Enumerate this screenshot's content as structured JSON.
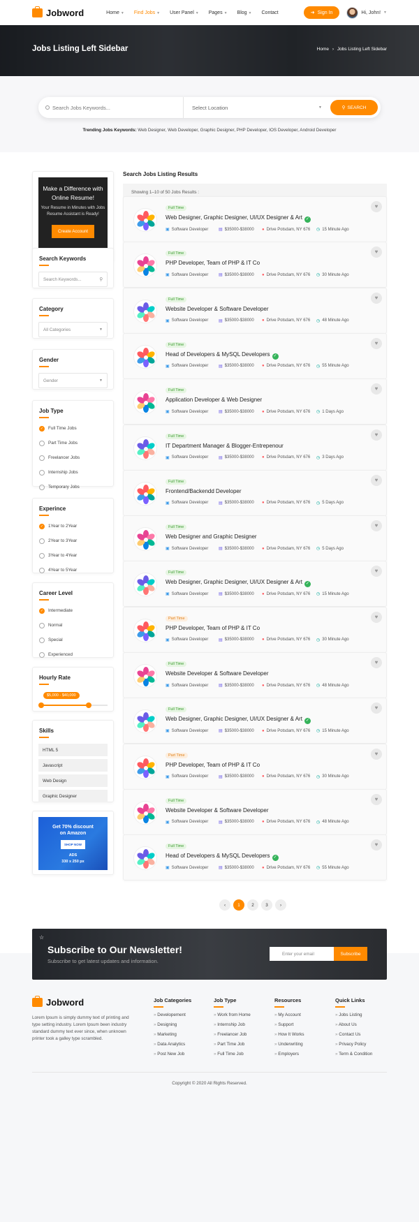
{
  "brand": {
    "name": "Jobword"
  },
  "nav": {
    "items": [
      "Home",
      "Find Jobs",
      "User Panel",
      "Pages",
      "Blog",
      "Contact"
    ],
    "signin": "Sign In",
    "user": "Hi, John!"
  },
  "hero": {
    "title": "Jobs Listing Left Sidebar",
    "crumb_home": "Home",
    "crumb_sep": "›",
    "crumb_current": "Jobs Listing Left Sidebar"
  },
  "search": {
    "keywords_placeholder": "Search Jobs Keywords...",
    "location": "Select Location",
    "button": "SEARCH",
    "trending_label": "Trending Jobs Keywords:",
    "trending": " Web Designer, Web Developer, Graphic Designer, PHP Developer, IOS Developer, Android Developer"
  },
  "sidebar": {
    "promo": {
      "title": "Make a Difference with Online Resume!",
      "text": "Your Resume in Minutes with Jobs Resume Assistant is Ready!",
      "button": "Create Account"
    },
    "keywords": {
      "title": "Search Keywords",
      "placeholder": "Search Keywords..."
    },
    "category": {
      "title": "Category",
      "value": "All Categories"
    },
    "gender": {
      "title": "Gender",
      "value": "Gender"
    },
    "job_type": {
      "title": "Job Type",
      "options": [
        "Full Time Jobs",
        "Part Time Jobs",
        "Freelancer Jobs",
        "Internship Jobs",
        "Temporary Jobs"
      ]
    },
    "experience": {
      "title": "Experince",
      "options": [
        "1Year to 2Year",
        "2Year to 3Year",
        "3Year to 4Year",
        "4Year to 5Year"
      ]
    },
    "career": {
      "title": "Career Level",
      "options": [
        "Intermediate",
        "Normal",
        "Special",
        "Experienced"
      ]
    },
    "rate": {
      "title": "Hourly Rate",
      "range": "$5,000 - $40,000"
    },
    "skills": {
      "title": "Skills",
      "items": [
        "HTML 5",
        "Javascript",
        "Web Design",
        "Graphic Designer"
      ]
    },
    "ad": {
      "line1": "Get 70% discount",
      "line2": "on Amazon",
      "shop": "SHOP NOW",
      "ads": "ADS",
      "size": "330 x 250 px"
    }
  },
  "main": {
    "title": "Search Jobs Listing Results",
    "count": "Showing 1–10 of 50 Jobs Results :"
  },
  "jobs": [
    {
      "type": "Full Time",
      "title": "Web Designer, Graphic Designer, UI/UX Designer & Art",
      "verified": true,
      "cat": "Software Developer",
      "salary": "$35000-$38000",
      "loc": "Drive Potsdam, NY 676",
      "time": "15 Minute Ago"
    },
    {
      "type": "Full Time",
      "title": "PHP Developer, Team of PHP & IT Co",
      "verified": false,
      "cat": "Software Developer",
      "salary": "$35000-$38000",
      "loc": "Drive Potsdam, NY 676",
      "time": "30 Minute Ago"
    },
    {
      "type": "Full Time",
      "title": "Website Developer & Software Developer",
      "verified": false,
      "cat": "Software Developer",
      "salary": "$35000-$38000",
      "loc": "Drive Potsdam, NY 676",
      "time": "48 Minute Ago"
    },
    {
      "type": "Full Time",
      "title": "Head of Developers & MySQL Developers",
      "verified": true,
      "cat": "Software Developer",
      "salary": "$35000-$38000",
      "loc": "Drive Potsdam, NY 676",
      "time": "55 Minute Ago"
    },
    {
      "type": "Full Time",
      "title": "Application Developer & Web Designer",
      "verified": false,
      "cat": "Software Developer",
      "salary": "$35000-$38000",
      "loc": "Drive Potsdam, NY 676",
      "time": "1 Days Ago"
    },
    {
      "type": "Full Time",
      "title": "IT Department Manager & Blogger-Entrepenour",
      "verified": false,
      "cat": "Software Developer",
      "salary": "$35000-$38000",
      "loc": "Drive Potsdam, NY 676",
      "time": "3 Days Ago"
    },
    {
      "type": "Full Time",
      "title": "Frontend/Backendd Developer",
      "verified": false,
      "cat": "Software Developer",
      "salary": "$35000-$38000",
      "loc": "Drive Potsdam, NY 676",
      "time": "5 Days Ago"
    },
    {
      "type": "Full Time",
      "title": "Web Designer and Graphic Designer",
      "verified": false,
      "cat": "Software Developer",
      "salary": "$35000-$38000",
      "loc": "Drive Potsdam, NY 676",
      "time": "5 Days Ago"
    },
    {
      "type": "Full Time",
      "title": "Web Designer, Graphic Designer, UI/UX Designer & Art",
      "verified": true,
      "cat": "Software Developer",
      "salary": "$35000-$38000",
      "loc": "Drive Potsdam, NY 676",
      "time": "15 Minute Ago"
    },
    {
      "type": "Part Time",
      "title": "PHP Developer, Team of PHP & IT Co",
      "verified": false,
      "cat": "Software Developer",
      "salary": "$35000-$38000",
      "loc": "Drive Potsdam, NY 676",
      "time": "30 Minute Ago"
    },
    {
      "type": "Full Time",
      "title": "Website Developer & Software Developer",
      "verified": false,
      "cat": "Software Developer",
      "salary": "$35000-$38000",
      "loc": "Drive Potsdam, NY 676",
      "time": "48 Minute Ago"
    },
    {
      "type": "Full Time",
      "title": "Web Designer, Graphic Designer, UI/UX Designer & Art",
      "verified": true,
      "cat": "Software Developer",
      "salary": "$35000-$38000",
      "loc": "Drive Potsdam, NY 676",
      "time": "15 Minute Ago"
    },
    {
      "type": "Part Time",
      "title": "PHP Developer, Team of PHP & IT Co",
      "verified": false,
      "cat": "Software Developer",
      "salary": "$35000-$38000",
      "loc": "Drive Potsdam, NY 676",
      "time": "30 Minute Ago"
    },
    {
      "type": "Full Time",
      "title": "Website Developer & Software Developer",
      "verified": false,
      "cat": "Software Developer",
      "salary": "$35000-$38000",
      "loc": "Drive Potsdam, NY 676",
      "time": "48 Minute Ago"
    },
    {
      "type": "Full Time",
      "title": "Head of Developers & MySQL Developers",
      "verified": true,
      "cat": "Software Developer",
      "salary": "$35000-$38000",
      "loc": "Drive Potsdam, NY 676",
      "time": "55 Minute Ago"
    }
  ],
  "pagination": {
    "prev": "‹",
    "pages": [
      "1",
      "2",
      "3"
    ],
    "next": "›"
  },
  "newsletter": {
    "title": "Subscribe to Our Newsletter!",
    "subtitle": "Subscribe to get latest updates and information.",
    "placeholder": "Enter your email",
    "button": "Subscribe"
  },
  "footer": {
    "about": "Lorem Ipsum is simply dummy text of printing and type setting industry. Lorem Ipsum been industry standard dummy text ever since, when unknown printer took a galley type scrambled.",
    "cols": [
      {
        "title": "Job Categories",
        "items": [
          "Developement",
          "Designing",
          "Marketing",
          "Data Analytics",
          "Post New Job"
        ]
      },
      {
        "title": "Job Type",
        "items": [
          "Work from Home",
          "Internship Job",
          "Freelancer Job",
          "Part Time Job",
          "Full Time Job"
        ]
      },
      {
        "title": "Resources",
        "items": [
          "My Account",
          "Support",
          "How It Works",
          "Underwriting",
          "Employers"
        ]
      },
      {
        "title": "Quick Links",
        "items": [
          "Jobs Listing",
          "About Us",
          "Contact Us",
          "Privacy Policy",
          "Term & Condition"
        ]
      }
    ],
    "copyright": "Copyright © 2020 All Rights Reserved."
  },
  "colors": {
    "accent": "#ff8a00",
    "full_time": "#3a9b2f",
    "part_time": "#e0831c",
    "verified": "#35b35a"
  }
}
